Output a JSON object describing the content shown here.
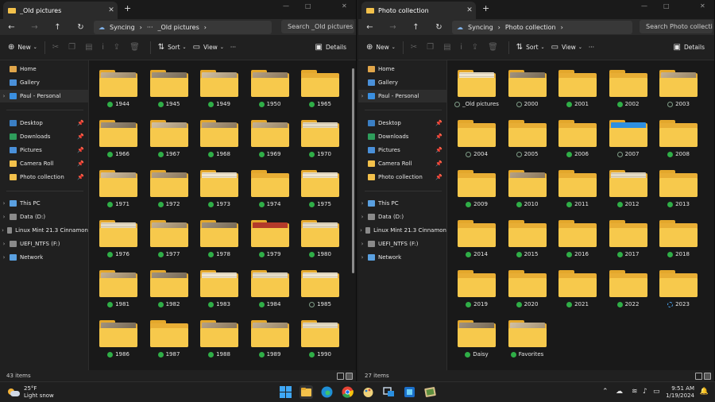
{
  "windows": [
    {
      "tab_title": "_Old pictures",
      "sync_label": "Syncing",
      "breadcrumb": "_Old pictures",
      "search_placeholder": "Search _Old pictures",
      "status_count": "43 items",
      "folders": [
        {
          "name": "1944",
          "status": "synced",
          "thumb": "photo"
        },
        {
          "name": "1945",
          "status": "synced",
          "thumb": "photo"
        },
        {
          "name": "1949",
          "status": "synced",
          "thumb": "photo"
        },
        {
          "name": "1950",
          "status": "synced",
          "thumb": "photo"
        },
        {
          "name": "1965",
          "status": "synced",
          "thumb": "none"
        },
        {
          "name": "1966",
          "status": "synced",
          "thumb": "photo"
        },
        {
          "name": "1967",
          "status": "synced",
          "thumb": "photo"
        },
        {
          "name": "1968",
          "status": "synced",
          "thumb": "photo"
        },
        {
          "name": "1969",
          "status": "synced",
          "thumb": "photo"
        },
        {
          "name": "1970",
          "status": "synced",
          "thumb": "paper"
        },
        {
          "name": "1971",
          "status": "synced",
          "thumb": "photo"
        },
        {
          "name": "1972",
          "status": "synced",
          "thumb": "photo"
        },
        {
          "name": "1973",
          "status": "synced",
          "thumb": "paper"
        },
        {
          "name": "1974",
          "status": "synced",
          "thumb": "none"
        },
        {
          "name": "1975",
          "status": "synced",
          "thumb": "paper"
        },
        {
          "name": "1976",
          "status": "synced",
          "thumb": "paper"
        },
        {
          "name": "1977",
          "status": "synced",
          "thumb": "photo"
        },
        {
          "name": "1978",
          "status": "synced",
          "thumb": "photo"
        },
        {
          "name": "1979",
          "status": "synced",
          "thumb": "red"
        },
        {
          "name": "1980",
          "status": "synced",
          "thumb": "paper"
        },
        {
          "name": "1981",
          "status": "synced",
          "thumb": "photo"
        },
        {
          "name": "1982",
          "status": "synced",
          "thumb": "photo"
        },
        {
          "name": "1983",
          "status": "synced",
          "thumb": "paper"
        },
        {
          "name": "1984",
          "status": "synced",
          "thumb": "paper"
        },
        {
          "name": "1985",
          "status": "cloud",
          "thumb": "paper"
        },
        {
          "name": "1986",
          "status": "synced",
          "thumb": "photo"
        },
        {
          "name": "1987",
          "status": "synced",
          "thumb": "none"
        },
        {
          "name": "1988",
          "status": "synced",
          "thumb": "photo"
        },
        {
          "name": "1989",
          "status": "synced",
          "thumb": "photo"
        },
        {
          "name": "1990",
          "status": "synced",
          "thumb": "paper"
        }
      ]
    },
    {
      "tab_title": "Photo collection",
      "sync_label": "Syncing",
      "breadcrumb": "Photo collection",
      "search_placeholder": "Search Photo collection",
      "status_count": "27 items",
      "folders": [
        {
          "name": "_Old pictures",
          "status": "cloud",
          "thumb": "paper"
        },
        {
          "name": "2000",
          "status": "cloud",
          "thumb": "photo"
        },
        {
          "name": "2001",
          "status": "synced",
          "thumb": "none"
        },
        {
          "name": "2002",
          "status": "synced",
          "thumb": "none"
        },
        {
          "name": "2003",
          "status": "cloud",
          "thumb": "photo"
        },
        {
          "name": "2004",
          "status": "cloud",
          "thumb": "none"
        },
        {
          "name": "2005",
          "status": "cloud",
          "thumb": "none"
        },
        {
          "name": "2006",
          "status": "synced",
          "thumb": "none"
        },
        {
          "name": "2007",
          "status": "cloud",
          "thumb": "blue"
        },
        {
          "name": "2008",
          "status": "synced",
          "thumb": "none"
        },
        {
          "name": "2009",
          "status": "synced",
          "thumb": "none"
        },
        {
          "name": "2010",
          "status": "synced",
          "thumb": "photo"
        },
        {
          "name": "2011",
          "status": "synced",
          "thumb": "none"
        },
        {
          "name": "2012",
          "status": "synced",
          "thumb": "paper"
        },
        {
          "name": "2013",
          "status": "synced",
          "thumb": "none"
        },
        {
          "name": "2014",
          "status": "synced",
          "thumb": "none"
        },
        {
          "name": "2015",
          "status": "synced",
          "thumb": "none"
        },
        {
          "name": "2016",
          "status": "synced",
          "thumb": "none"
        },
        {
          "name": "2017",
          "status": "synced",
          "thumb": "none"
        },
        {
          "name": "2018",
          "status": "synced",
          "thumb": "none"
        },
        {
          "name": "2019",
          "status": "synced",
          "thumb": "none"
        },
        {
          "name": "2020",
          "status": "synced",
          "thumb": "none"
        },
        {
          "name": "2021",
          "status": "synced",
          "thumb": "none"
        },
        {
          "name": "2022",
          "status": "synced",
          "thumb": "none"
        },
        {
          "name": "2023",
          "status": "syncing",
          "thumb": "none"
        },
        {
          "name": "Daisy",
          "status": "synced",
          "thumb": "photo"
        },
        {
          "name": "Favorites",
          "status": "synced",
          "thumb": "photo"
        }
      ]
    }
  ],
  "toolbar": {
    "new_label": "New",
    "sort_label": "Sort",
    "view_label": "View",
    "more_label": "···",
    "details_label": "Details"
  },
  "nav": {
    "home": "Home",
    "gallery": "Gallery",
    "personal": "Paul - Personal",
    "desktop": "Desktop",
    "downloads": "Downloads",
    "pictures": "Pictures",
    "camera_roll": "Camera Roll",
    "photo_collection": "Photo collection",
    "this_pc": "This PC",
    "data_d": "Data (D:)",
    "linux_mint": "Linux Mint 21.3 Cinnamon",
    "uefi": "UEFI_NTFS (F:)",
    "network": "Network"
  },
  "taskbar": {
    "temperature": "25°F",
    "condition": "Light snow",
    "time": "9:51 AM",
    "date": "1/19/2024"
  },
  "colors": {
    "synced": "#2fae47",
    "folder": "#f7c94c",
    "accent": "#4aa3f0"
  }
}
